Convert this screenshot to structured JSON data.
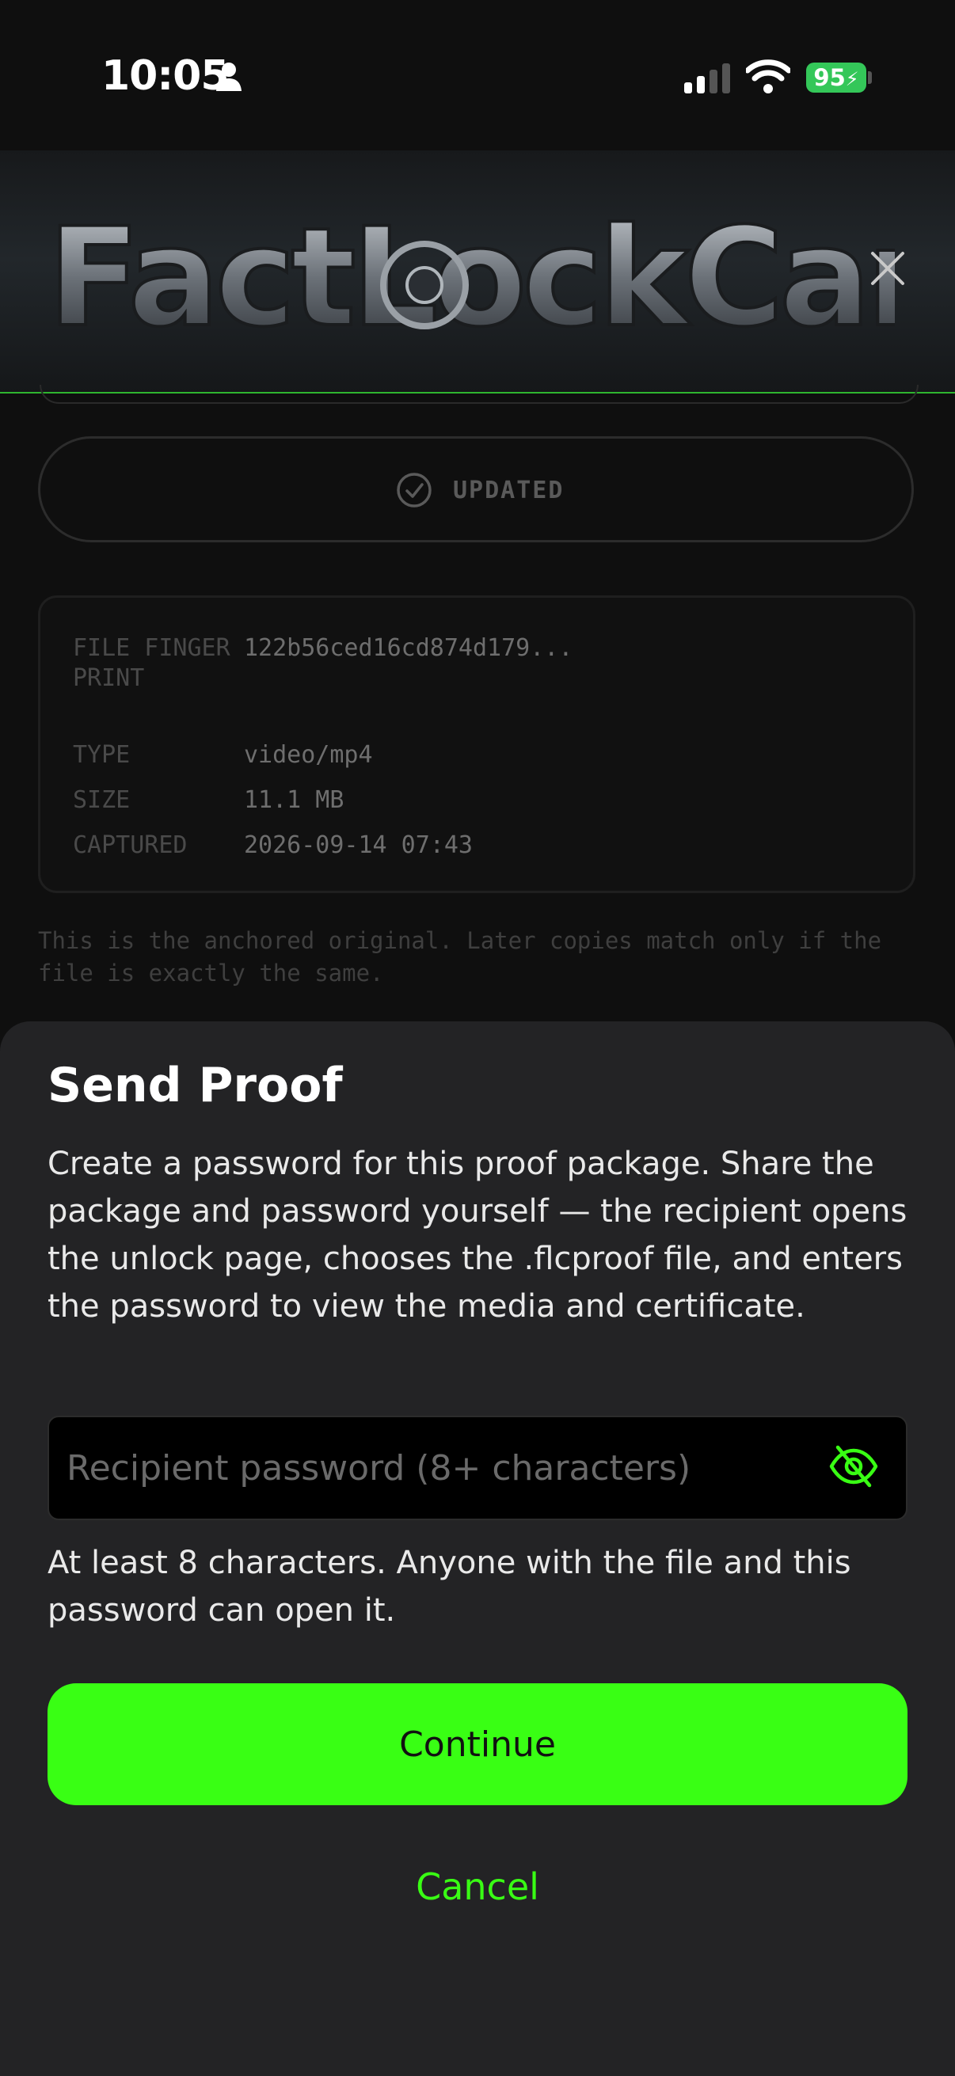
{
  "status_bar": {
    "time": "10:05",
    "battery": "95",
    "icons": [
      "person-icon",
      "signal-icon",
      "wifi-icon",
      "battery-charging-icon"
    ]
  },
  "header": {
    "logo_text": "FactLockCam",
    "close_icon": "close-icon"
  },
  "verification": {
    "status_label": "UPDATED",
    "status_icon": "check-circle-icon"
  },
  "file_info": {
    "rows": [
      {
        "key": "FILE FINGERPRINT",
        "value": "122b56ced16cd874d179..."
      },
      {
        "key": "TYPE",
        "value": "video/mp4"
      },
      {
        "key": "SIZE",
        "value": "11.1 MB"
      },
      {
        "key": "CAPTURED",
        "value": "2026-09-14 07:43"
      }
    ]
  },
  "note": "This is the anchored original. Later copies match only if the file is exactly the same.",
  "sheet": {
    "title": "Send Proof",
    "description": "Create a password for this proof package. Share the package and password yourself — the recipient opens the unlock page, chooses the .flcproof file, and enters the password to view the media and certificate.",
    "password_value": "",
    "password_placeholder": "Recipient password (8+ characters)",
    "toggle_icon": "eye-slash-icon",
    "hint": "At least 8 characters. Anyone with the file and this password can open it.",
    "continue_label": "Continue",
    "cancel_label": "Cancel"
  },
  "colors": {
    "accent": "#39ff14",
    "sheet_bg": "#232325",
    "page_bg": "#0f0f0f",
    "battery": "#34c759"
  }
}
